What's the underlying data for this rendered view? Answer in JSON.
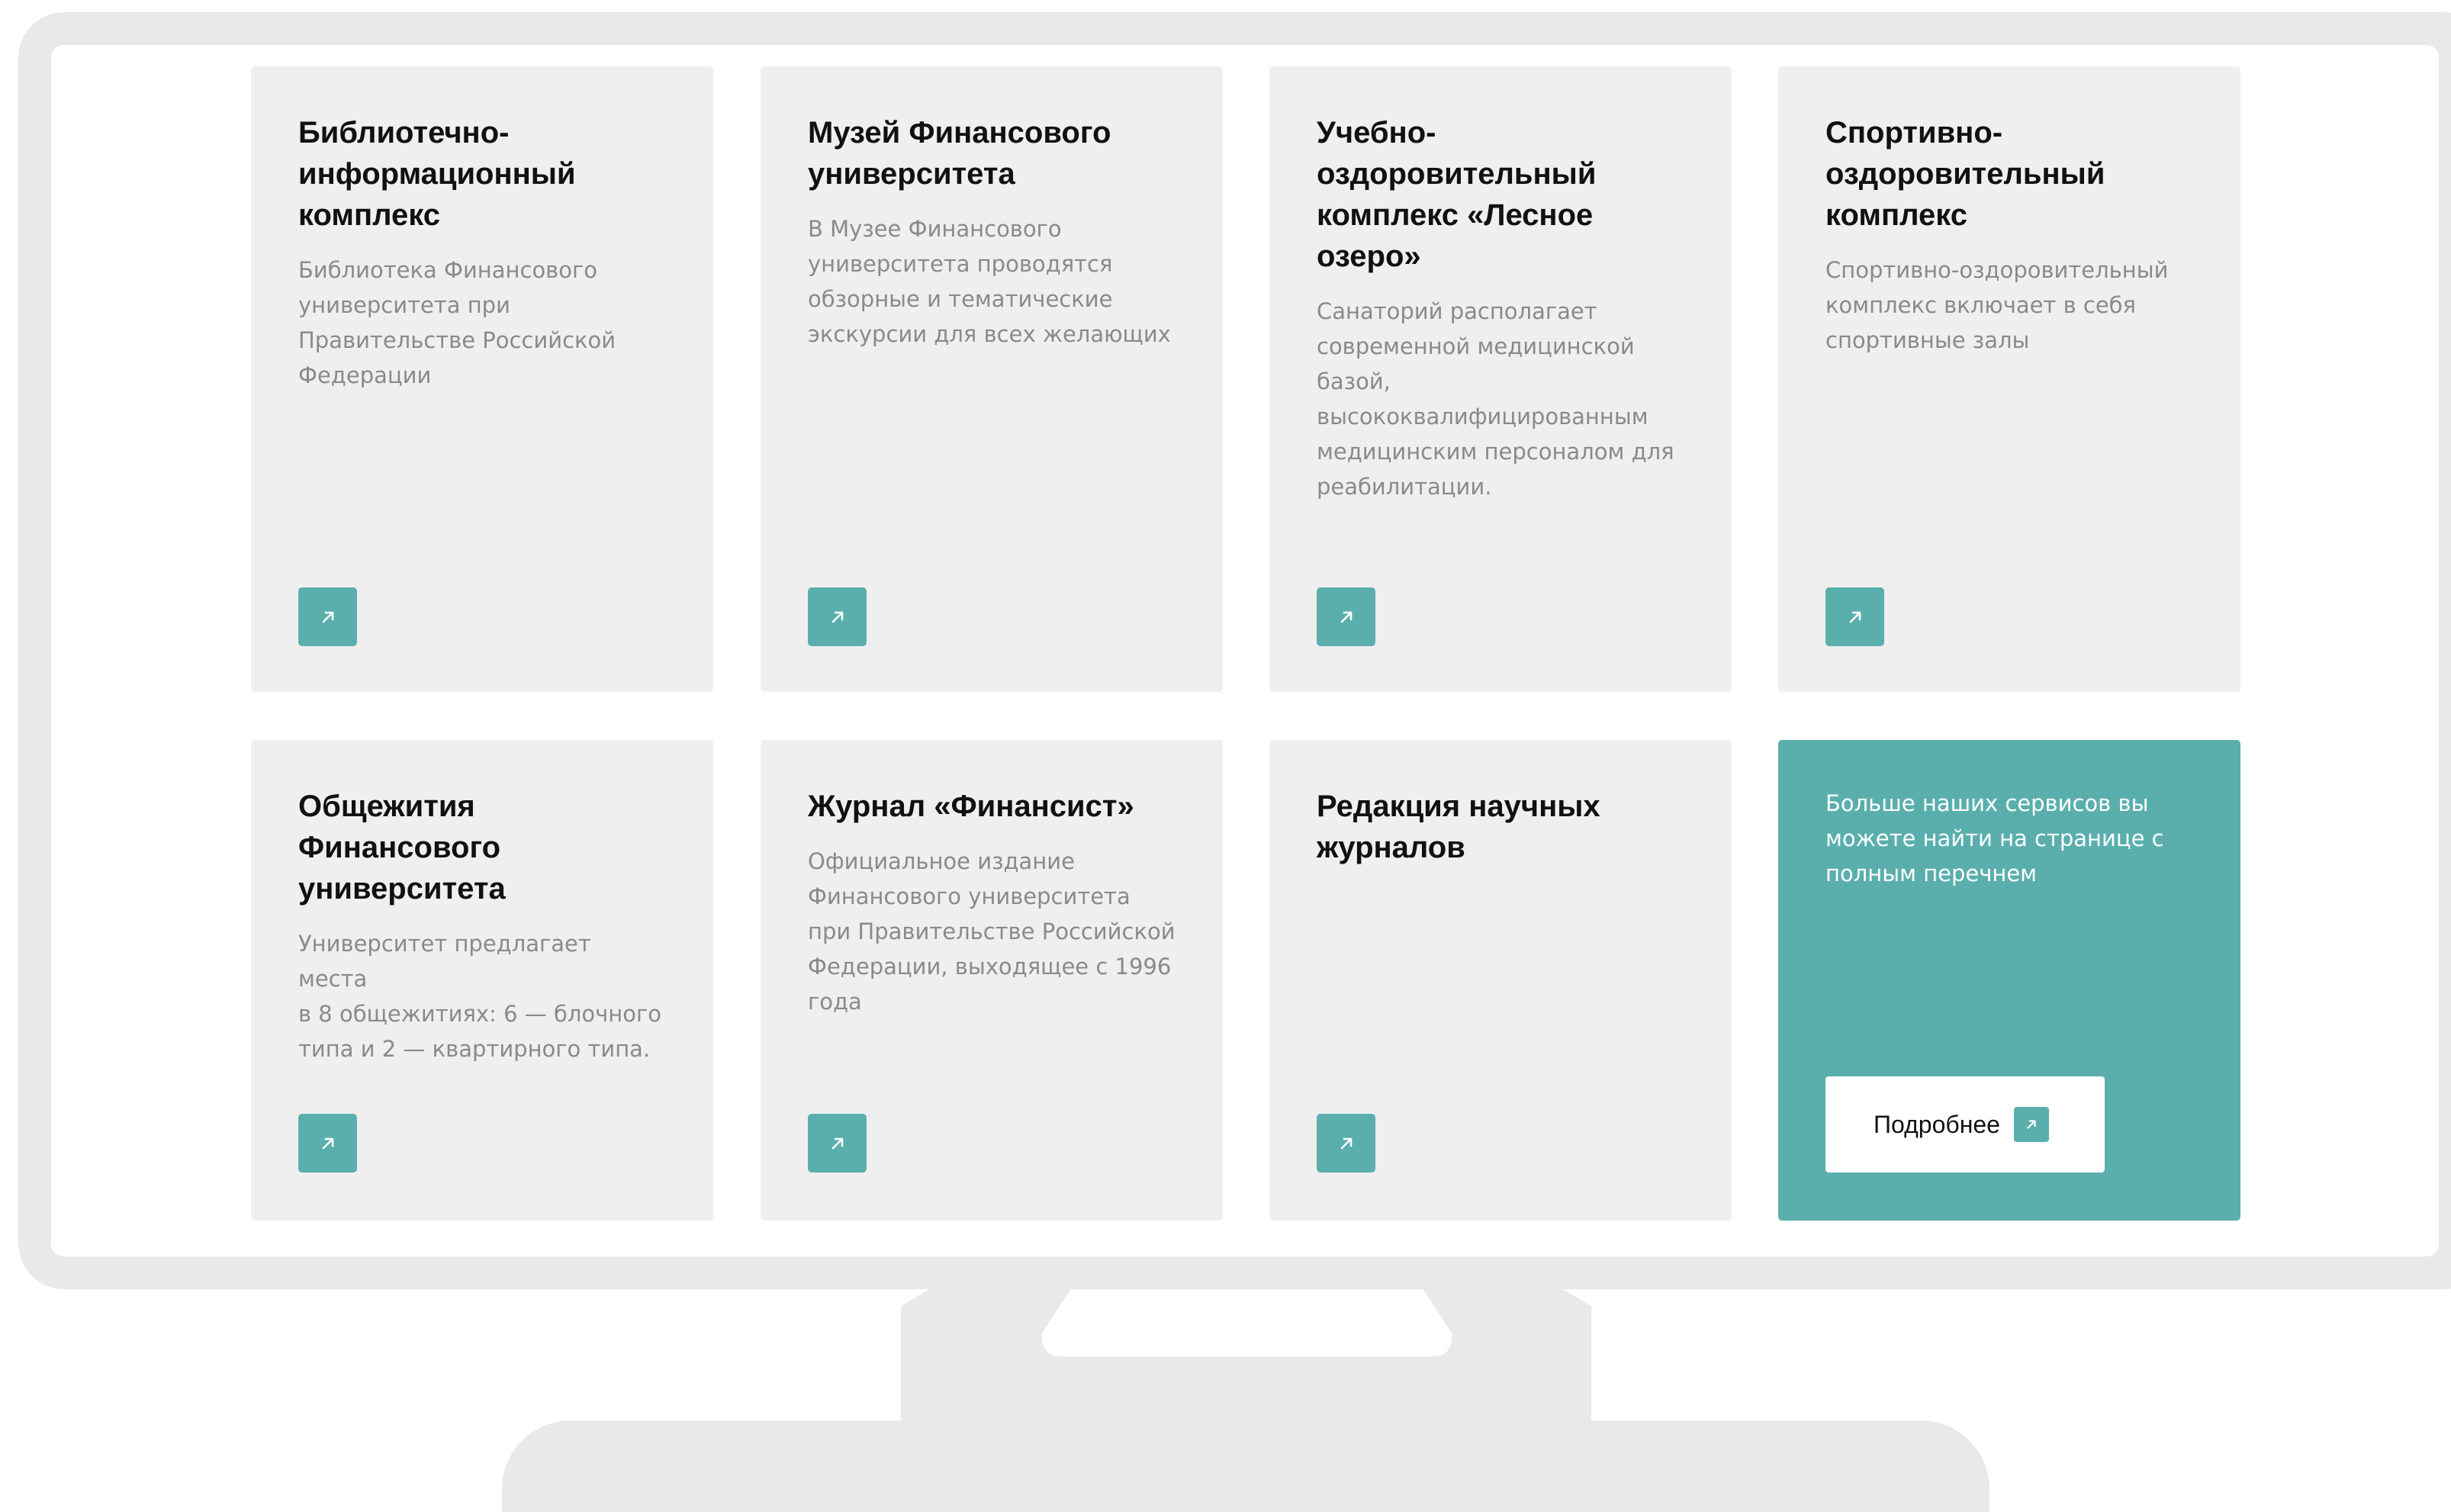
{
  "cards": [
    {
      "title": "Библиотечно-\nинформационный\nкомплекс",
      "description": "Библиотека Финансового\nуниверситета при\nПравительстве Российской\nФедерации",
      "icon": "arrow-up-right-icon"
    },
    {
      "title": "Музей Финансового\nуниверситета",
      "description": "В Музее Финансового\nуниверситета проводятся\nобзорные и тематические\nэкскурсии для всех желающих",
      "icon": "arrow-up-right-icon"
    },
    {
      "title": "Учебно-\nоздоровительный\nкомплекс «Лесное\nозеро»",
      "description": "Санаторий располагает\nсовременной медицинской\nбазой,\nвысококвалифицированным\nмедицинским персоналом для\nреабилитации.",
      "icon": "arrow-up-right-icon"
    },
    {
      "title": "Спортивно-\nоздоровительный\nкомплекс",
      "description": "Спортивно-оздоровительный\nкомплекс включает в себя\nспортивные залы",
      "icon": "arrow-up-right-icon"
    },
    {
      "title": "Общежития\nФинансового\nуниверситета",
      "description": "Университет предлагает места\nв 8 общежитиях: 6 — блочного\nтипа и 2 — квартирного типа.",
      "icon": "arrow-up-right-icon"
    },
    {
      "title": "Журнал «Финансист»",
      "description": "Официальное издание\nФинансового университета\nпри Правительстве Российской\nФедерации, выходящее с 1996\nгода",
      "icon": "arrow-up-right-icon"
    },
    {
      "title": "Редакция научных\nжурналов",
      "description": "",
      "icon": "arrow-up-right-icon"
    }
  ],
  "cta": {
    "text": "Больше наших сервисов  вы\nможете найти на странице  с\nполным перечнем",
    "button_label": "Подробнее",
    "icon": "arrow-up-right-icon"
  },
  "colors": {
    "accent": "#5aafad",
    "card_background": "#efefef",
    "frame": "#e8e9e8",
    "title_text": "#111111",
    "description_text": "#8a8a8a"
  }
}
